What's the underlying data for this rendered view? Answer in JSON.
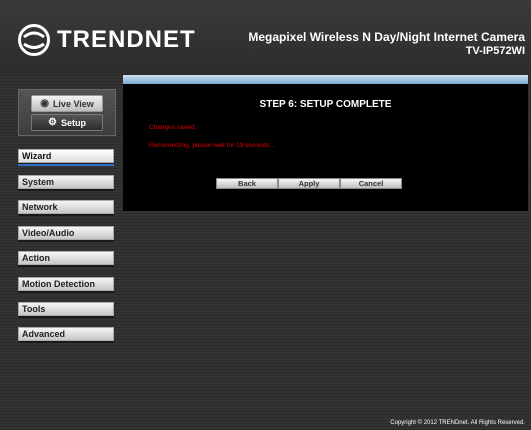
{
  "brand": {
    "logo_text": "TRENDNET"
  },
  "product": {
    "title": "Megapixel Wireless N Day/Night Internet Camera",
    "model": "TV-IP572WI"
  },
  "view_buttons": [
    {
      "label": "Live View",
      "icon": "camera-icon"
    },
    {
      "label": "Setup",
      "icon": "gear-icon"
    }
  ],
  "nav": [
    {
      "label": "Wizard",
      "active": true
    },
    {
      "label": "System"
    },
    {
      "label": "Network"
    },
    {
      "label": "Video/Audio"
    },
    {
      "label": "Action"
    },
    {
      "label": "Motion Detection"
    },
    {
      "label": "Tools"
    },
    {
      "label": "Advanced"
    }
  ],
  "wizard": {
    "title": "STEP 6: SETUP COMPLETE",
    "message_saved": "Changes saved.",
    "message_reconnect": "Reconnecting, please wait for 19 seconds...",
    "buttons": {
      "back": "Back",
      "apply": "Apply",
      "cancel": "Cancel"
    }
  },
  "footer": {
    "copyright": "Copyright © 2012 TRENDnet. All Rights Reserved."
  },
  "colors": {
    "accent_blue": "#2d6ec9",
    "error_red": "#e00000"
  }
}
